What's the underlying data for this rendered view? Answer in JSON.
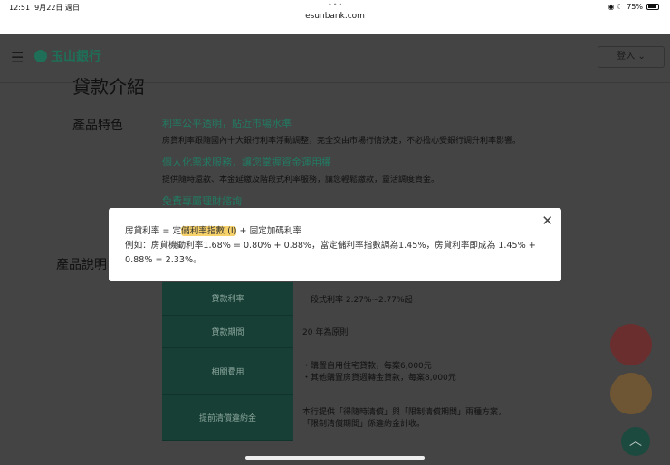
{
  "status_bar": {
    "time": "12:51",
    "date": "9月22日 週日",
    "battery": "75%",
    "url": "esunbank.com",
    "dots": "•••"
  },
  "header": {
    "menu_icon": "☰",
    "logo": "玉山銀行",
    "login": "登入"
  },
  "page": {
    "title": "貸款介紹",
    "features_label": "產品特色",
    "details_label": "產品說明",
    "features": [
      {
        "title": "利率公平透明，貼近市場水準",
        "desc": "房貸利率跟隨國內十大銀行利率浮動調整，完全交由市場行情決定，不必擔心受銀行調升利率影響。"
      },
      {
        "title": "個人化需求服務，讓您掌握資金運用權",
        "desc": "提供隨時還款、本金延繳及階段式利率服務，讓您輕鬆繳款，靈活調度資金。"
      },
      {
        "title": "免費專屬理財諮詢",
        "desc": ""
      }
    ],
    "table": [
      {
        "k": "貸款利率",
        "v": [
          "一段式利率 2.27%~2.77%起"
        ]
      },
      {
        "k": "貸款期間",
        "v": [
          "20 年為原則"
        ]
      },
      {
        "k": "相關費用",
        "v": [
          "・購置自用住宅貸款，每案6,000元",
          "・其他購置房貸週轉金貸款，每案8,000元"
        ]
      },
      {
        "k": "提前清償違約金",
        "v": [
          "本行提供「得隨時清償」與「限制清償期間」兩種方案，",
          "「限制清償期間」係違約金計收。"
        ]
      }
    ]
  },
  "modal": {
    "pre": "房貸利率 = 定",
    "highlight": "儲利率指數 (I)",
    "post": " + 固定加碼利率",
    "line2": "例如：房貸機動利率1.68% = 0.80% + 0.88%，當定儲利率指數調為1.45%，房貸利率即成為 1.45% +",
    "line3": "0.88% = 2.33%。",
    "close": "✕"
  },
  "fab": {
    "up": "︿"
  }
}
